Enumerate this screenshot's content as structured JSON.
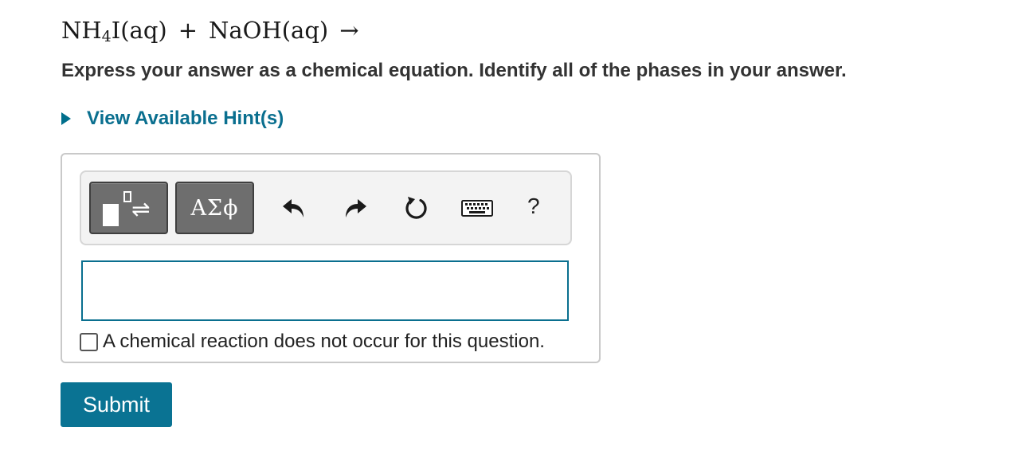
{
  "question": {
    "equation": {
      "reactant1_prefix": "NH",
      "reactant1_subscript": "4",
      "reactant1_suffix": "I(aq)",
      "plus": "+",
      "reactant2": "NaOH(aq)",
      "arrow": "→"
    },
    "instructions": "Express your answer as a chemical equation. Identify all of the phases in your answer."
  },
  "hints": {
    "label": "View Available Hint(s)",
    "icon": "caret-right-icon"
  },
  "toolbar": {
    "templates_icon": "templates-icon",
    "symbols_label": "ΑΣϕ",
    "undo_icon": "undo-icon",
    "redo_icon": "redo-icon",
    "reset_icon": "reset-icon",
    "keyboard_icon": "keyboard-icon",
    "help_label": "?"
  },
  "answer": {
    "value": "",
    "no_reaction_label": "A chemical reaction does not occur for this question.",
    "no_reaction_checked": false
  },
  "submit": {
    "label": "Submit"
  },
  "colors": {
    "accent": "#0a7393",
    "link": "#0a6f8f",
    "toolbar_button": "#6e6e6e",
    "box_border": "#c9c9c9"
  }
}
